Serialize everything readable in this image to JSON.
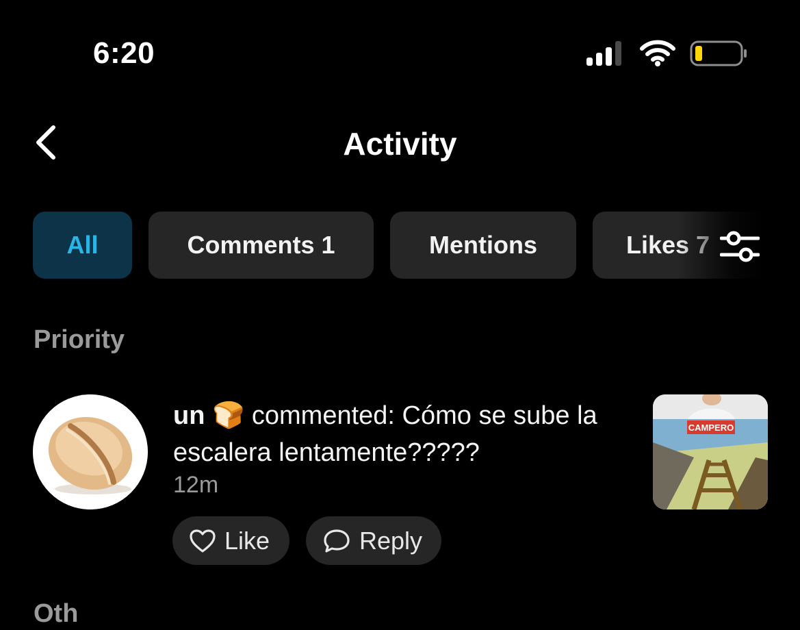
{
  "status_bar": {
    "time": "6:20",
    "battery_color": "#ffd60a"
  },
  "header": {
    "title": "Activity",
    "back_icon": "chevron-left-icon"
  },
  "tabs": [
    {
      "label": "All",
      "selected": true
    },
    {
      "label": "Comments 1",
      "selected": false
    },
    {
      "label": "Mentions",
      "selected": false
    },
    {
      "label": "Likes 7",
      "selected": false
    }
  ],
  "filter_icon": "sliders-icon",
  "priority": {
    "heading": "Priority",
    "item": {
      "username": "un",
      "emoji": "🍞",
      "action": "commented: Cómo se sube la escalera lentamente?????",
      "time": "12m",
      "thumbnail_text": "CAMPERO",
      "like_label": "Like",
      "reply_label": "Reply"
    }
  },
  "next_section": {
    "heading": "Oth"
  },
  "colors": {
    "accent": "#29b6e6",
    "accent_bg": "#0c3348",
    "chip_bg": "#262626"
  }
}
